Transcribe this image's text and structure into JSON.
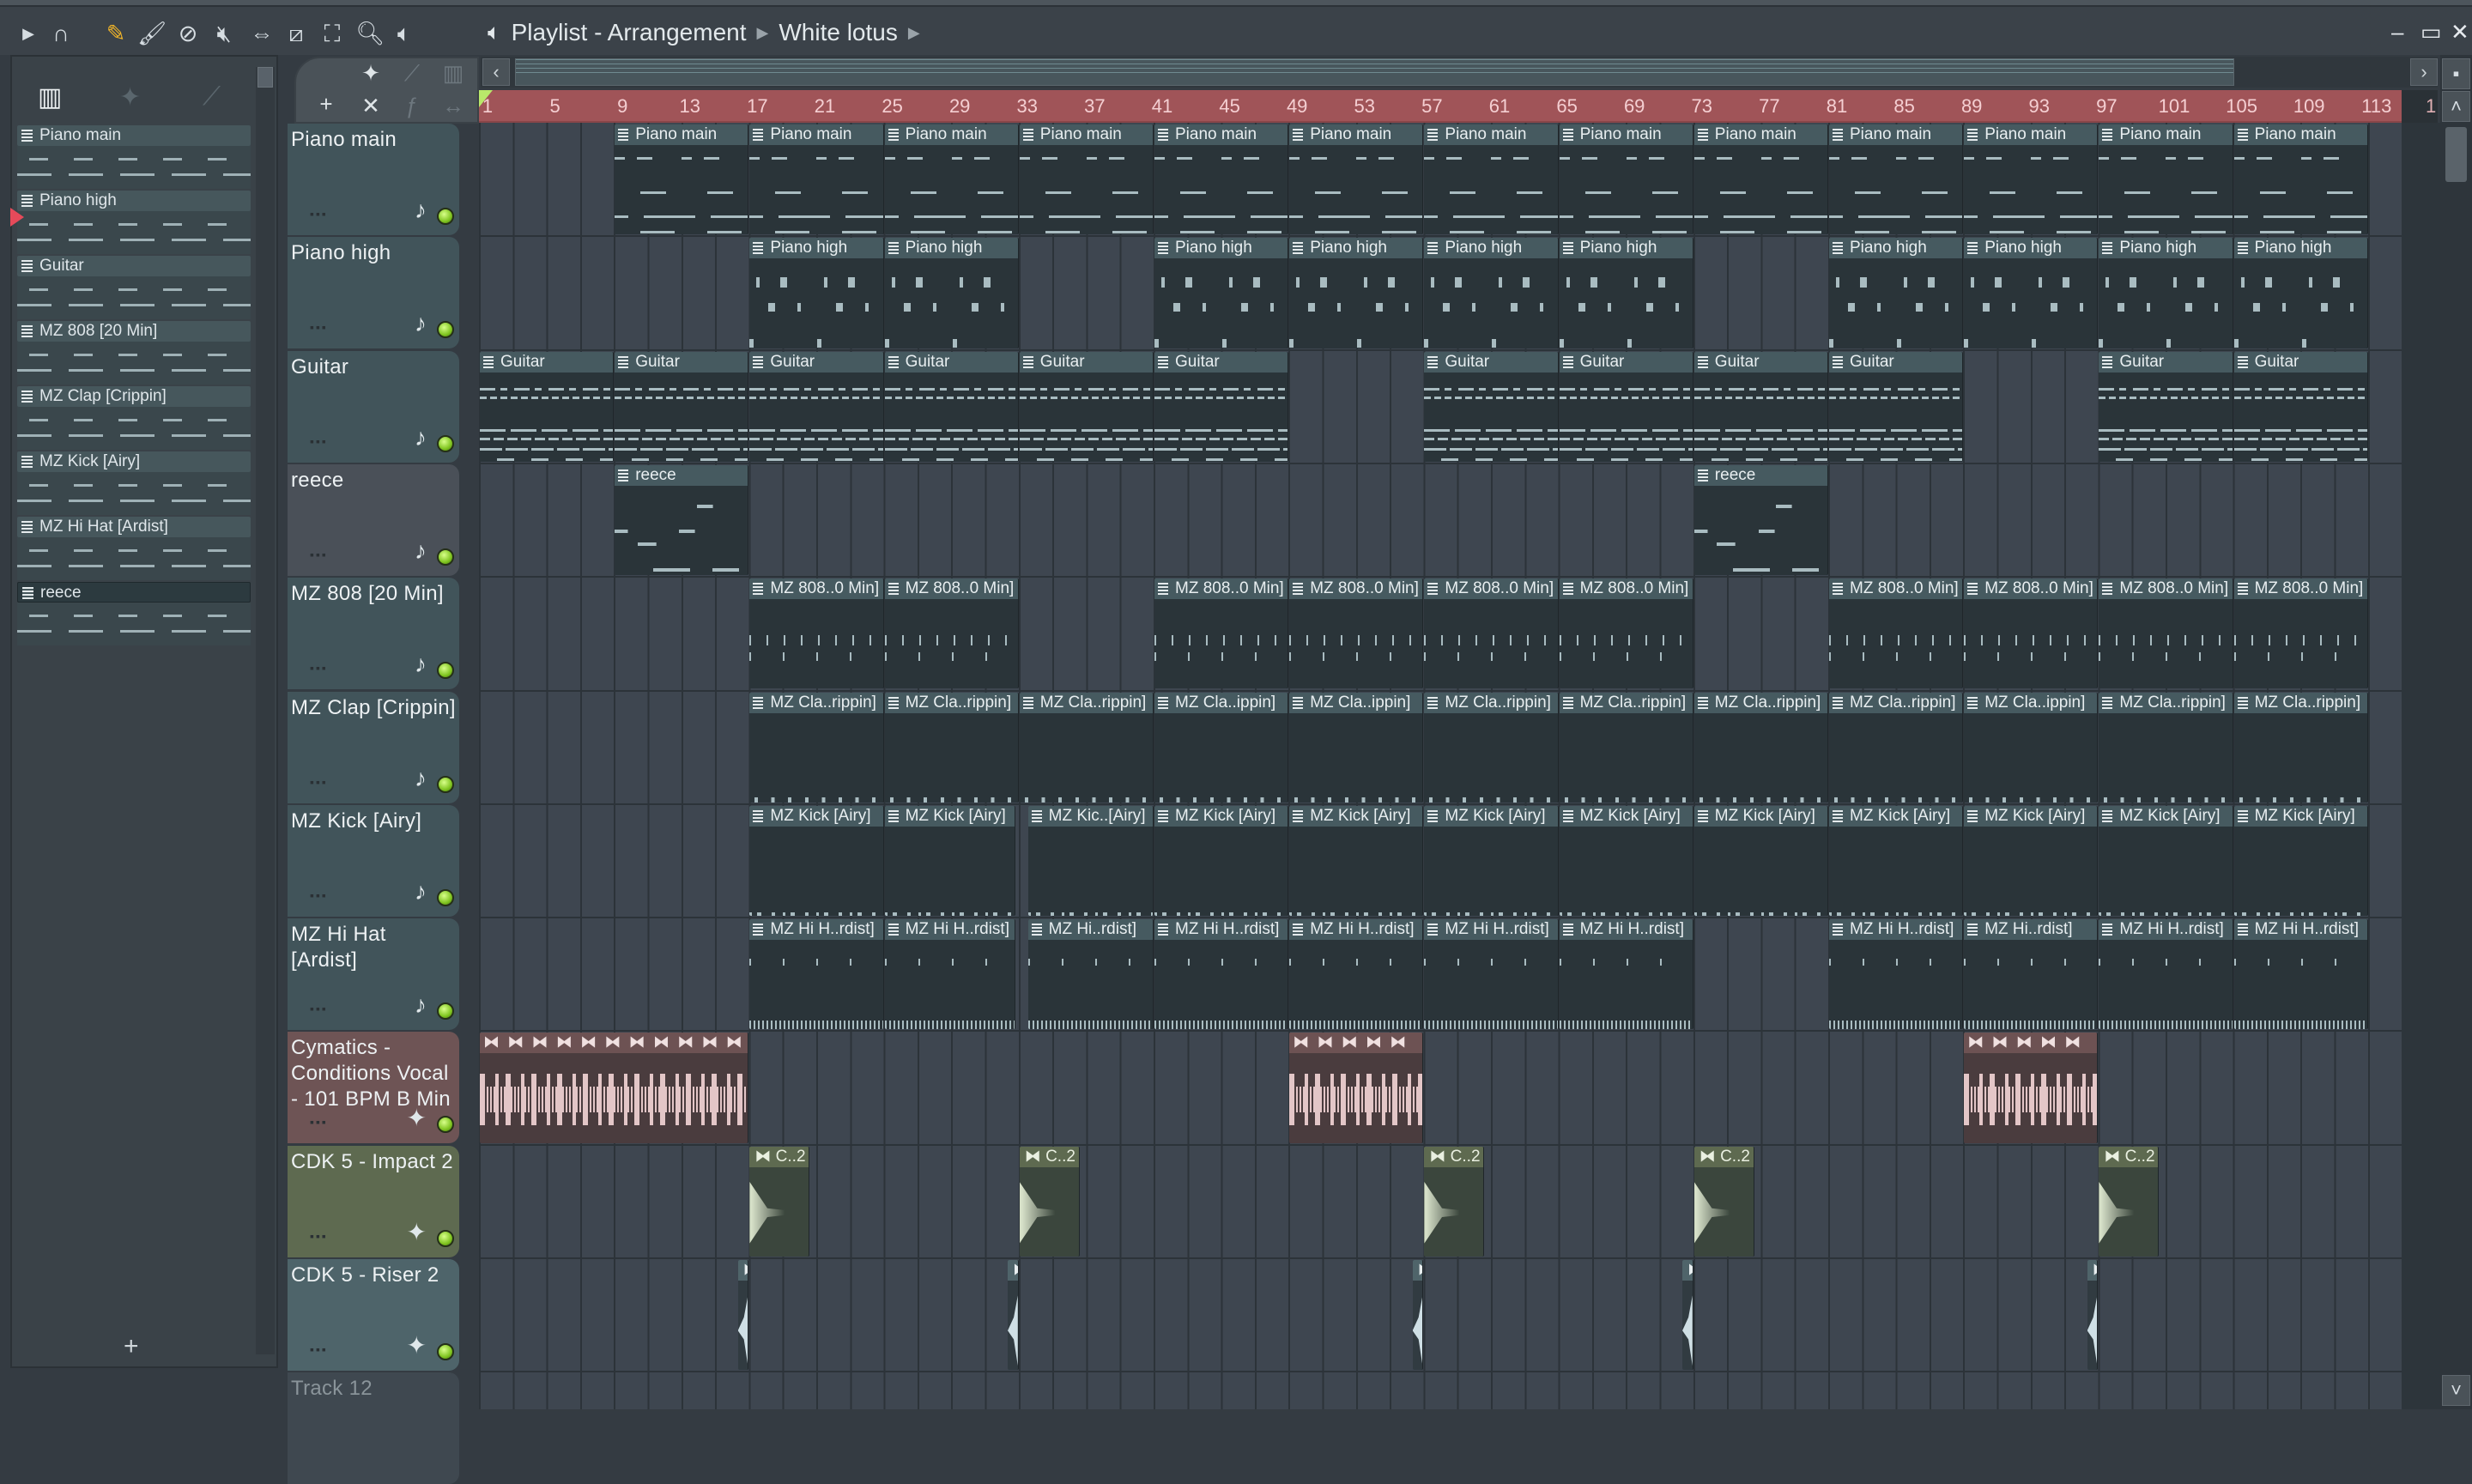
{
  "window": {
    "title": "Playlist - Arrangement",
    "arrangement": "White lotus",
    "controls": [
      "minimize",
      "maximize",
      "close"
    ]
  },
  "toolbar": {
    "icons": [
      "play-icon",
      "magnet-icon",
      "pencil-icon",
      "paint-icon",
      "delete-icon",
      "mute-icon",
      "slip-icon",
      "slice-icon",
      "select-icon",
      "zoom-icon",
      "playback-icon"
    ],
    "accent": "#f0b429"
  },
  "picker": {
    "patterns": [
      {
        "label": "Piano main"
      },
      {
        "label": "Piano high"
      },
      {
        "label": "Guitar"
      },
      {
        "label": "MZ 808 [20 Min]"
      },
      {
        "label": "MZ Clap [Crippin]"
      },
      {
        "label": "MZ Kick [Airy]"
      },
      {
        "label": "MZ Hi Hat [Ardist]"
      },
      {
        "label": "reece",
        "selected": true
      }
    ],
    "add_label": "+"
  },
  "ruler": {
    "ticks": [
      "1",
      "5",
      "9",
      "13",
      "17",
      "21",
      "25",
      "29",
      "33",
      "37",
      "41",
      "45",
      "49",
      "53",
      "57",
      "61",
      "65",
      "69",
      "73",
      "77",
      "81",
      "85",
      "89",
      "93",
      "97",
      "101",
      "105",
      "109",
      "113"
    ],
    "tail": "1",
    "color": "#a05458"
  },
  "tracks": [
    {
      "name": "Piano main",
      "kind": "note",
      "color": "#41545a",
      "style": "notes-a",
      "clips": [
        {
          "start": 9,
          "len": 8,
          "label": "Piano main"
        },
        {
          "start": 17,
          "len": 8,
          "label": "Piano main"
        },
        {
          "start": 25,
          "len": 8,
          "label": "Piano main"
        },
        {
          "start": 33,
          "len": 8,
          "label": "Piano main"
        },
        {
          "start": 41,
          "len": 8,
          "label": "Piano main"
        },
        {
          "start": 49,
          "len": 8,
          "label": "Piano main"
        },
        {
          "start": 57,
          "len": 8,
          "label": "Piano main"
        },
        {
          "start": 65,
          "len": 8,
          "label": "Piano main"
        },
        {
          "start": 73,
          "len": 8,
          "label": "Piano main"
        },
        {
          "start": 81,
          "len": 8,
          "label": "Piano main"
        },
        {
          "start": 89,
          "len": 8,
          "label": "Piano main"
        },
        {
          "start": 97,
          "len": 8,
          "label": "Piano main"
        },
        {
          "start": 105,
          "len": 8,
          "label": "Piano main"
        }
      ]
    },
    {
      "name": "Piano high",
      "kind": "note",
      "color": "#41545a",
      "style": "notes-b",
      "clips": [
        {
          "start": 17,
          "len": 8,
          "label": "Piano high"
        },
        {
          "start": 25,
          "len": 8,
          "label": "Piano high"
        },
        {
          "start": 41,
          "len": 8,
          "label": "Piano high"
        },
        {
          "start": 49,
          "len": 8,
          "label": "Piano high"
        },
        {
          "start": 57,
          "len": 8,
          "label": "Piano high"
        },
        {
          "start": 65,
          "len": 8,
          "label": "Piano high"
        },
        {
          "start": 81,
          "len": 8,
          "label": "Piano high"
        },
        {
          "start": 89,
          "len": 8,
          "label": "Piano high"
        },
        {
          "start": 97,
          "len": 8,
          "label": "Piano high"
        },
        {
          "start": 105,
          "len": 8,
          "label": "Piano high"
        }
      ]
    },
    {
      "name": "Guitar",
      "kind": "note",
      "color": "#41545a",
      "style": "notes-g",
      "clips": [
        {
          "start": 1,
          "len": 8,
          "label": "Guitar"
        },
        {
          "start": 9,
          "len": 8,
          "label": "Guitar"
        },
        {
          "start": 17,
          "len": 8,
          "label": "Guitar"
        },
        {
          "start": 25,
          "len": 8,
          "label": "Guitar"
        },
        {
          "start": 33,
          "len": 8,
          "label": "Guitar"
        },
        {
          "start": 41,
          "len": 8,
          "label": "Guitar"
        },
        {
          "start": 57,
          "len": 8,
          "label": "Guitar"
        },
        {
          "start": 65,
          "len": 8,
          "label": "Guitar"
        },
        {
          "start": 73,
          "len": 8,
          "label": "Guitar"
        },
        {
          "start": 81,
          "len": 8,
          "label": "Guitar"
        },
        {
          "start": 97,
          "len": 8,
          "label": "Guitar"
        },
        {
          "start": 105,
          "len": 8,
          "label": "Guitar"
        }
      ]
    },
    {
      "name": "reece",
      "kind": "note",
      "color": "#4a5058",
      "style": "notes-r",
      "clips": [
        {
          "start": 9,
          "len": 8,
          "label": "reece"
        },
        {
          "start": 73,
          "len": 8,
          "label": "reece"
        }
      ]
    },
    {
      "name": "MZ 808 [20 Min]",
      "kind": "note",
      "color": "#41545a",
      "style": "notes-808",
      "clips": [
        {
          "start": 17,
          "len": 8,
          "label": "MZ 808..0 Min]"
        },
        {
          "start": 25,
          "len": 8,
          "label": "MZ 808..0 Min]"
        },
        {
          "start": 41,
          "len": 8,
          "label": "MZ 808..0 Min]"
        },
        {
          "start": 49,
          "len": 8,
          "label": "MZ 808..0 Min]"
        },
        {
          "start": 57,
          "len": 8,
          "label": "MZ 808..0 Min]"
        },
        {
          "start": 65,
          "len": 8,
          "label": "MZ 808..0 Min]"
        },
        {
          "start": 81,
          "len": 8,
          "label": "MZ 808..0 Min]"
        },
        {
          "start": 89,
          "len": 8,
          "label": "MZ 808..0 Min]"
        },
        {
          "start": 97,
          "len": 8,
          "label": "MZ 808..0 Min]"
        },
        {
          "start": 105,
          "len": 8,
          "label": "MZ 808..0 Min]"
        }
      ]
    },
    {
      "name": "MZ Clap [Crippin]",
      "kind": "note",
      "color": "#41545a",
      "style": "notes-clap",
      "clips": [
        {
          "start": 17,
          "len": 8,
          "label": "MZ Cla..rippin]"
        },
        {
          "start": 25,
          "len": 8,
          "label": "MZ Cla..rippin]"
        },
        {
          "start": 33,
          "len": 8,
          "label": "MZ Cla..rippin]"
        },
        {
          "start": 41,
          "len": 8,
          "label": "MZ Cla..ippin]"
        },
        {
          "start": 49,
          "len": 8,
          "label": "MZ Cla..ippin]"
        },
        {
          "start": 57,
          "len": 8,
          "label": "MZ Cla..rippin]"
        },
        {
          "start": 65,
          "len": 8,
          "label": "MZ Cla..rippin]"
        },
        {
          "start": 73,
          "len": 8,
          "label": "MZ Cla..rippin]"
        },
        {
          "start": 81,
          "len": 8,
          "label": "MZ Cla..rippin]"
        },
        {
          "start": 89,
          "len": 8,
          "label": "MZ Cla..ippin]"
        },
        {
          "start": 97,
          "len": 8,
          "label": "MZ Cla..rippin]"
        },
        {
          "start": 105,
          "len": 8,
          "label": "MZ Cla..rippin]"
        }
      ]
    },
    {
      "name": "MZ Kick [Airy]",
      "kind": "note",
      "color": "#41545a",
      "style": "notes-kick",
      "clips": [
        {
          "start": 17,
          "len": 8,
          "label": "MZ Kick [Airy]"
        },
        {
          "start": 25,
          "len": 7.8,
          "label": "MZ Kick [Airy]"
        },
        {
          "start": 33.5,
          "len": 7.5,
          "label": "MZ Kic..[Airy]"
        },
        {
          "start": 41,
          "len": 8,
          "label": "MZ Kick [Airy]"
        },
        {
          "start": 49,
          "len": 8,
          "label": "MZ Kick [Airy]"
        },
        {
          "start": 57,
          "len": 8,
          "label": "MZ Kick [Airy]"
        },
        {
          "start": 65,
          "len": 8,
          "label": "MZ Kick [Airy]"
        },
        {
          "start": 73,
          "len": 8,
          "label": "MZ Kick [Airy]"
        },
        {
          "start": 81,
          "len": 8,
          "label": "MZ Kick [Airy]"
        },
        {
          "start": 89,
          "len": 8,
          "label": "MZ Kick [Airy]"
        },
        {
          "start": 97,
          "len": 8,
          "label": "MZ Kick [Airy]"
        },
        {
          "start": 105,
          "len": 8,
          "label": "MZ Kick [Airy]"
        }
      ]
    },
    {
      "name": "MZ Hi Hat [Ardist]",
      "kind": "note",
      "color": "#41545a",
      "style": "notes-hat",
      "clips": [
        {
          "start": 17,
          "len": 8,
          "label": "MZ Hi H..rdist]"
        },
        {
          "start": 25,
          "len": 7.8,
          "label": "MZ Hi H..rdist]"
        },
        {
          "start": 33.5,
          "len": 7.5,
          "label": "MZ Hi..rdist]"
        },
        {
          "start": 41,
          "len": 8,
          "label": "MZ Hi H..rdist]"
        },
        {
          "start": 49,
          "len": 8,
          "label": "MZ Hi H..rdist]"
        },
        {
          "start": 57,
          "len": 8,
          "label": "MZ Hi H..rdist]"
        },
        {
          "start": 65,
          "len": 8,
          "label": "MZ Hi H..rdist]"
        },
        {
          "start": 81,
          "len": 8,
          "label": "MZ Hi H..rdist]"
        },
        {
          "start": 89,
          "len": 8,
          "label": "MZ Hi..rdist]"
        },
        {
          "start": 97,
          "len": 8,
          "label": "MZ Hi H..rdist]"
        },
        {
          "start": 105,
          "len": 8,
          "label": "MZ Hi H..rdist]"
        }
      ]
    },
    {
      "name": "Cymatics - Conditions Vocal - 101 BPM B Min",
      "kind": "audio",
      "color": "#6e5455",
      "style": "vocal",
      "clips": [
        {
          "start": 1,
          "len": 16,
          "label": "⧓ ⧓ ⧓ ⧓ ⧓ ⧓ ⧓ ⧓ ⧓ ⧓ ⧓"
        },
        {
          "start": 49,
          "len": 8,
          "label": "⧓ ⧓ ⧓ ⧓ ⧓"
        },
        {
          "start": 89,
          "len": 8,
          "label": "⧓ ⧓ ⧓ ⧓ ⧓"
        }
      ]
    },
    {
      "name": "CDK 5 - Impact 2",
      "kind": "audio",
      "color": "#5e6a50",
      "style": "impact",
      "clips": [
        {
          "start": 17,
          "len": 3.6,
          "label": "⧓ C..2"
        },
        {
          "start": 33,
          "len": 3.6,
          "label": "⧓ C..2"
        },
        {
          "start": 57,
          "len": 3.6,
          "label": "⧓ C..2"
        },
        {
          "start": 73,
          "len": 3.6,
          "label": "⧓ C..2"
        },
        {
          "start": 97,
          "len": 3.6,
          "label": "⧓ C..2"
        }
      ]
    },
    {
      "name": "CDK 5 - Riser 2",
      "kind": "audio",
      "color": "#4e646a",
      "style": "riser",
      "clips": [
        {
          "start": 16.3,
          "len": 0.7,
          "label": "⧓"
        },
        {
          "start": 32.3,
          "len": 0.7,
          "label": "⧓"
        },
        {
          "start": 56.3,
          "len": 0.7,
          "label": "⧓"
        },
        {
          "start": 72.3,
          "len": 0.7,
          "label": "⧓"
        },
        {
          "start": 96.3,
          "len": 0.7,
          "label": "⧓"
        }
      ]
    },
    {
      "name": "Track 12",
      "kind": "empty",
      "color": "#3f4850",
      "style": "",
      "clips": []
    }
  ]
}
